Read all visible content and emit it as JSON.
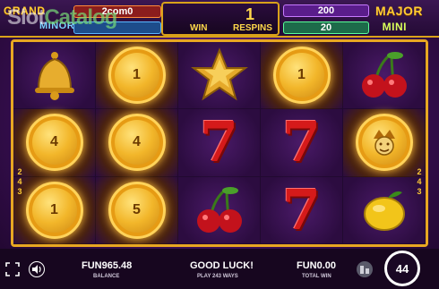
{
  "watermark": {
    "part1": "Slot",
    "part2": "Catalog"
  },
  "jackpots": {
    "grand": {
      "label": "GRAND",
      "value": "2com0"
    },
    "minor": {
      "label": "MINOR",
      "value": ""
    },
    "major": {
      "label": "MAJOR",
      "value": "200"
    },
    "mini": {
      "label": "MINI",
      "value": "20"
    }
  },
  "respin": {
    "win_label": "WIN",
    "count": "1",
    "label": "RESPINS"
  },
  "ways_side": [
    "2",
    "4",
    "3"
  ],
  "reels": [
    [
      {
        "type": "bell",
        "icon": "bell-icon"
      },
      {
        "type": "coin",
        "value": "4"
      },
      {
        "type": "coin",
        "value": "1"
      }
    ],
    [
      {
        "type": "coin",
        "value": "1"
      },
      {
        "type": "coin",
        "value": "4"
      },
      {
        "type": "coin",
        "value": "5"
      }
    ],
    [
      {
        "type": "star",
        "icon": "star-icon"
      },
      {
        "type": "seven",
        "value": "7"
      },
      {
        "type": "cherry",
        "icon": "cherry-icon"
      }
    ],
    [
      {
        "type": "coin",
        "value": "1"
      },
      {
        "type": "seven",
        "value": "7"
      },
      {
        "type": "seven",
        "value": "7"
      }
    ],
    [
      {
        "type": "cherry",
        "icon": "cherry-icon"
      },
      {
        "type": "jester-coin",
        "icon": "jester-coin-icon"
      },
      {
        "type": "lemon",
        "icon": "lemon-icon"
      }
    ]
  ],
  "bottom": {
    "balance_value": "FUN965.48",
    "balance_label": "BALANCE",
    "message": "GOOD LUCK!",
    "ways": "PLAY 243 WAYS",
    "total_win_value": "FUN0.00",
    "total_win_label": "TOTAL WIN",
    "spin_count": "44"
  },
  "colors": {
    "frame": "#e8a722",
    "coin": "#f2b62a",
    "seven": "#d51a1a",
    "background": "#3a0f55"
  }
}
